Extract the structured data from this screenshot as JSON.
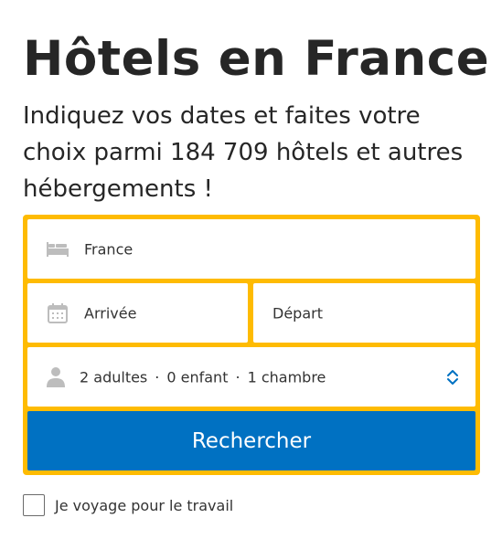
{
  "header": {
    "title": "Hôtels en France",
    "subtitle": "Indiquez vos dates et faites votre choix parmi 184 709 hôtels et autres hébergements !"
  },
  "search": {
    "destination_value": "France",
    "destination_icon": "bed-icon",
    "checkin_label": "Arrivée",
    "checkin_icon": "calendar-icon",
    "checkout_label": "Départ",
    "occupancy": {
      "icon": "person-icon",
      "adults": "2 adultes",
      "children": "0 enfant",
      "rooms": "1 chambre",
      "separator": "·",
      "toggle_icon": "chevron-up-down-icon"
    },
    "button_label": "Rechercher"
  },
  "business_travel": {
    "label": "Je voyage pour le travail",
    "checked": false
  },
  "colors": {
    "frame": "#febb02",
    "button": "#0071c2",
    "button_text": "#ffffff",
    "title_text": "#262626",
    "icon_gray": "#bdbdbd",
    "chevron": "#0071c2"
  }
}
